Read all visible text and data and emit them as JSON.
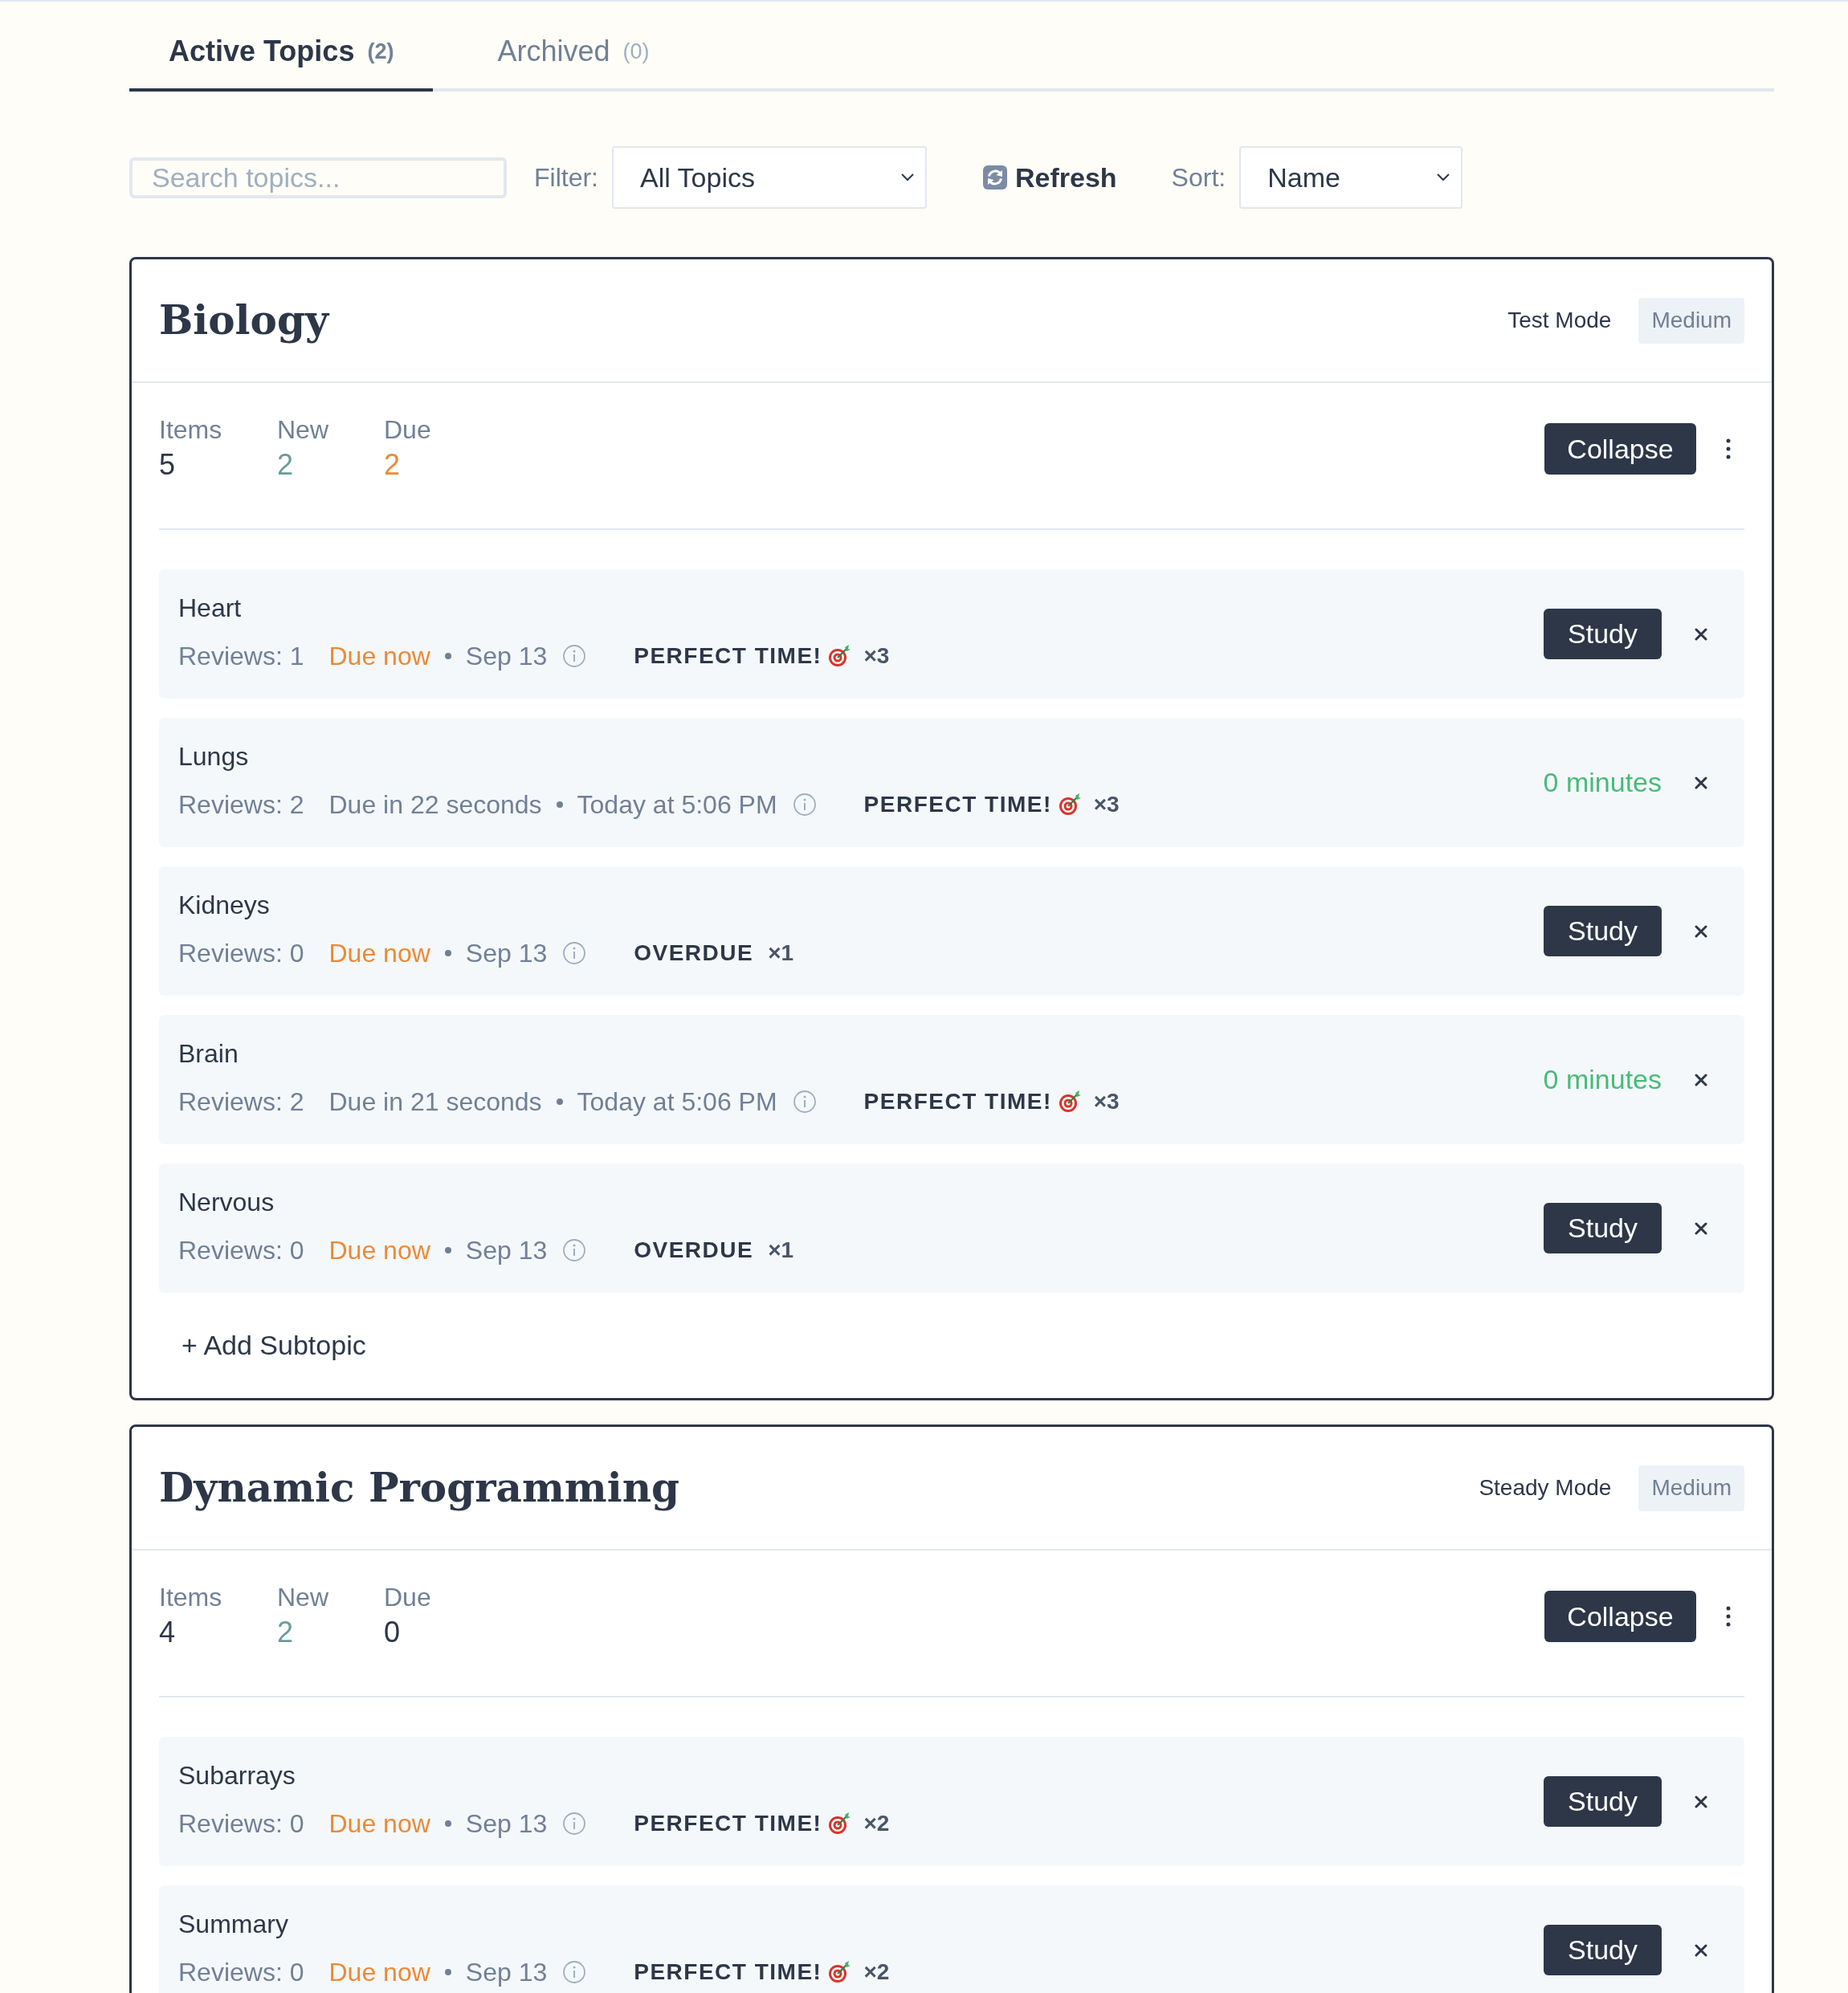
{
  "tabs": [
    {
      "label": "Active Topics",
      "count": "(2)",
      "selected": true
    },
    {
      "label": "Archived",
      "count": "(0)",
      "selected": false
    }
  ],
  "toolbar": {
    "search": {
      "placeholder": "Search topics..."
    },
    "filter": {
      "label": "Filter:",
      "value": "All Topics"
    },
    "refresh": {
      "label": "Refresh"
    },
    "sort": {
      "label": "Sort:",
      "value": "Name"
    }
  },
  "topics": [
    {
      "title": "Biology",
      "mode": "Test Mode",
      "difficulty": "Medium",
      "stats": [
        {
          "label": "Items",
          "value": "5",
          "color": "#2d3748"
        },
        {
          "label": "New",
          "value": "2",
          "color": "#6b9b9b"
        },
        {
          "label": "Due",
          "value": "2",
          "color": "#ed8936"
        }
      ],
      "collapse": "Collapse",
      "subtopics": [
        {
          "name": "Heart",
          "reviews": "Reviews: 1",
          "due": "Due now",
          "due_now": true,
          "date": "Sep 13",
          "badge": {
            "kind": "perfect",
            "label": "PERFECT TIME!",
            "count": "×3"
          },
          "action": {
            "kind": "study",
            "label": "Study"
          }
        },
        {
          "name": "Lungs",
          "reviews": "Reviews: 2",
          "due": "Due in 22 seconds",
          "due_now": false,
          "date": "Today at 5:06 PM",
          "badge": {
            "kind": "perfect",
            "label": "PERFECT TIME!",
            "count": "×3"
          },
          "action": {
            "kind": "timer",
            "label": "0 minutes"
          }
        },
        {
          "name": "Kidneys",
          "reviews": "Reviews: 0",
          "due": "Due now",
          "due_now": true,
          "date": "Sep 13",
          "badge": {
            "kind": "overdue",
            "label": "OVERDUE",
            "count": "×1"
          },
          "action": {
            "kind": "study",
            "label": "Study"
          }
        },
        {
          "name": "Brain",
          "reviews": "Reviews: 2",
          "due": "Due in 21 seconds",
          "due_now": false,
          "date": "Today at 5:06 PM",
          "badge": {
            "kind": "perfect",
            "label": "PERFECT TIME!",
            "count": "×3"
          },
          "action": {
            "kind": "timer",
            "label": "0 minutes"
          }
        },
        {
          "name": "Nervous",
          "reviews": "Reviews: 0",
          "due": "Due now",
          "due_now": true,
          "date": "Sep 13",
          "badge": {
            "kind": "overdue",
            "label": "OVERDUE",
            "count": "×1"
          },
          "action": {
            "kind": "study",
            "label": "Study"
          }
        }
      ],
      "add_subtopic": "+ Add Subtopic"
    },
    {
      "title": "Dynamic Programming",
      "mode": "Steady Mode",
      "difficulty": "Medium",
      "stats": [
        {
          "label": "Items",
          "value": "4",
          "color": "#2d3748"
        },
        {
          "label": "New",
          "value": "2",
          "color": "#6b9b9b"
        },
        {
          "label": "Due",
          "value": "0",
          "color": "#2d3748"
        }
      ],
      "collapse": "Collapse",
      "subtopics": [
        {
          "name": "Subarrays",
          "reviews": "Reviews: 0",
          "due": "Due now",
          "due_now": true,
          "date": "Sep 13",
          "badge": {
            "kind": "perfect",
            "label": "PERFECT TIME!",
            "count": "×2"
          },
          "action": {
            "kind": "study",
            "label": "Study"
          }
        },
        {
          "name": "Summary",
          "reviews": "Reviews: 0",
          "due": "Due now",
          "due_now": true,
          "date": "Sep 13",
          "badge": {
            "kind": "perfect",
            "label": "PERFECT TIME!",
            "count": "×2"
          },
          "action": {
            "kind": "study",
            "label": "Study"
          }
        }
      ]
    }
  ]
}
